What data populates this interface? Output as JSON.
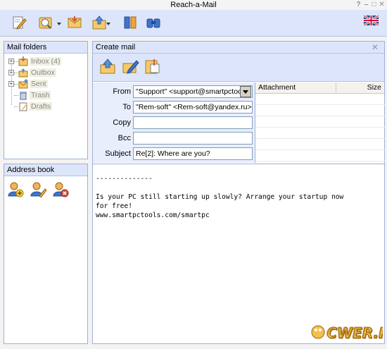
{
  "window": {
    "title": "Reach-a-Mail",
    "controls": [
      "?",
      "–",
      "□",
      "✕"
    ]
  },
  "toolbar": {
    "buttons": [
      "compose-icon",
      "check-mail-icon",
      "receive-icon",
      "send-icon",
      "address-book-icon",
      "find-icon"
    ],
    "language_flag": "uk-flag-icon"
  },
  "mail_folders": {
    "title": "Mail folders",
    "items": [
      {
        "label": "Inbox (4)",
        "icon": "inbox-icon",
        "expandable": true
      },
      {
        "label": "Outbox",
        "icon": "outbox-icon",
        "expandable": true
      },
      {
        "label": "Sent",
        "icon": "sent-icon",
        "expandable": true
      },
      {
        "label": "Trash",
        "icon": "trash-icon",
        "expandable": false
      },
      {
        "label": "Drafts",
        "icon": "drafts-icon",
        "expandable": false
      }
    ]
  },
  "address_book": {
    "title": "Address book",
    "buttons": [
      "add-contact-icon",
      "edit-contact-icon",
      "delete-contact-icon"
    ]
  },
  "create_mail": {
    "title": "Create mail",
    "toolbar": [
      "send-mail-icon",
      "sign-icon",
      "attach-icon"
    ],
    "fields": {
      "from_label": "From",
      "from_value": "\"Support\" <support@smartpctools",
      "to_label": "To",
      "to_value": "\"Rem-soft\" <Rem-soft@yandex.ru>",
      "copy_label": "Copy",
      "copy_value": "",
      "bcc_label": "Bcc",
      "bcc_value": "",
      "subject_label": "Subject",
      "subject_value": "Re[2]: Where are you?"
    },
    "attachments": {
      "col_attachment": "Attachment",
      "col_size": "Size"
    },
    "body": "--------------\n\nIs your PC still starting up slowly? Arrange your startup now\nfor free!\nwww.smartpctools.com/smartpc"
  },
  "watermark": "CWER.RU",
  "colors": {
    "panel_header": "#dde5fb",
    "border": "#9fb0d7",
    "form_bg": "#e9eefc"
  }
}
